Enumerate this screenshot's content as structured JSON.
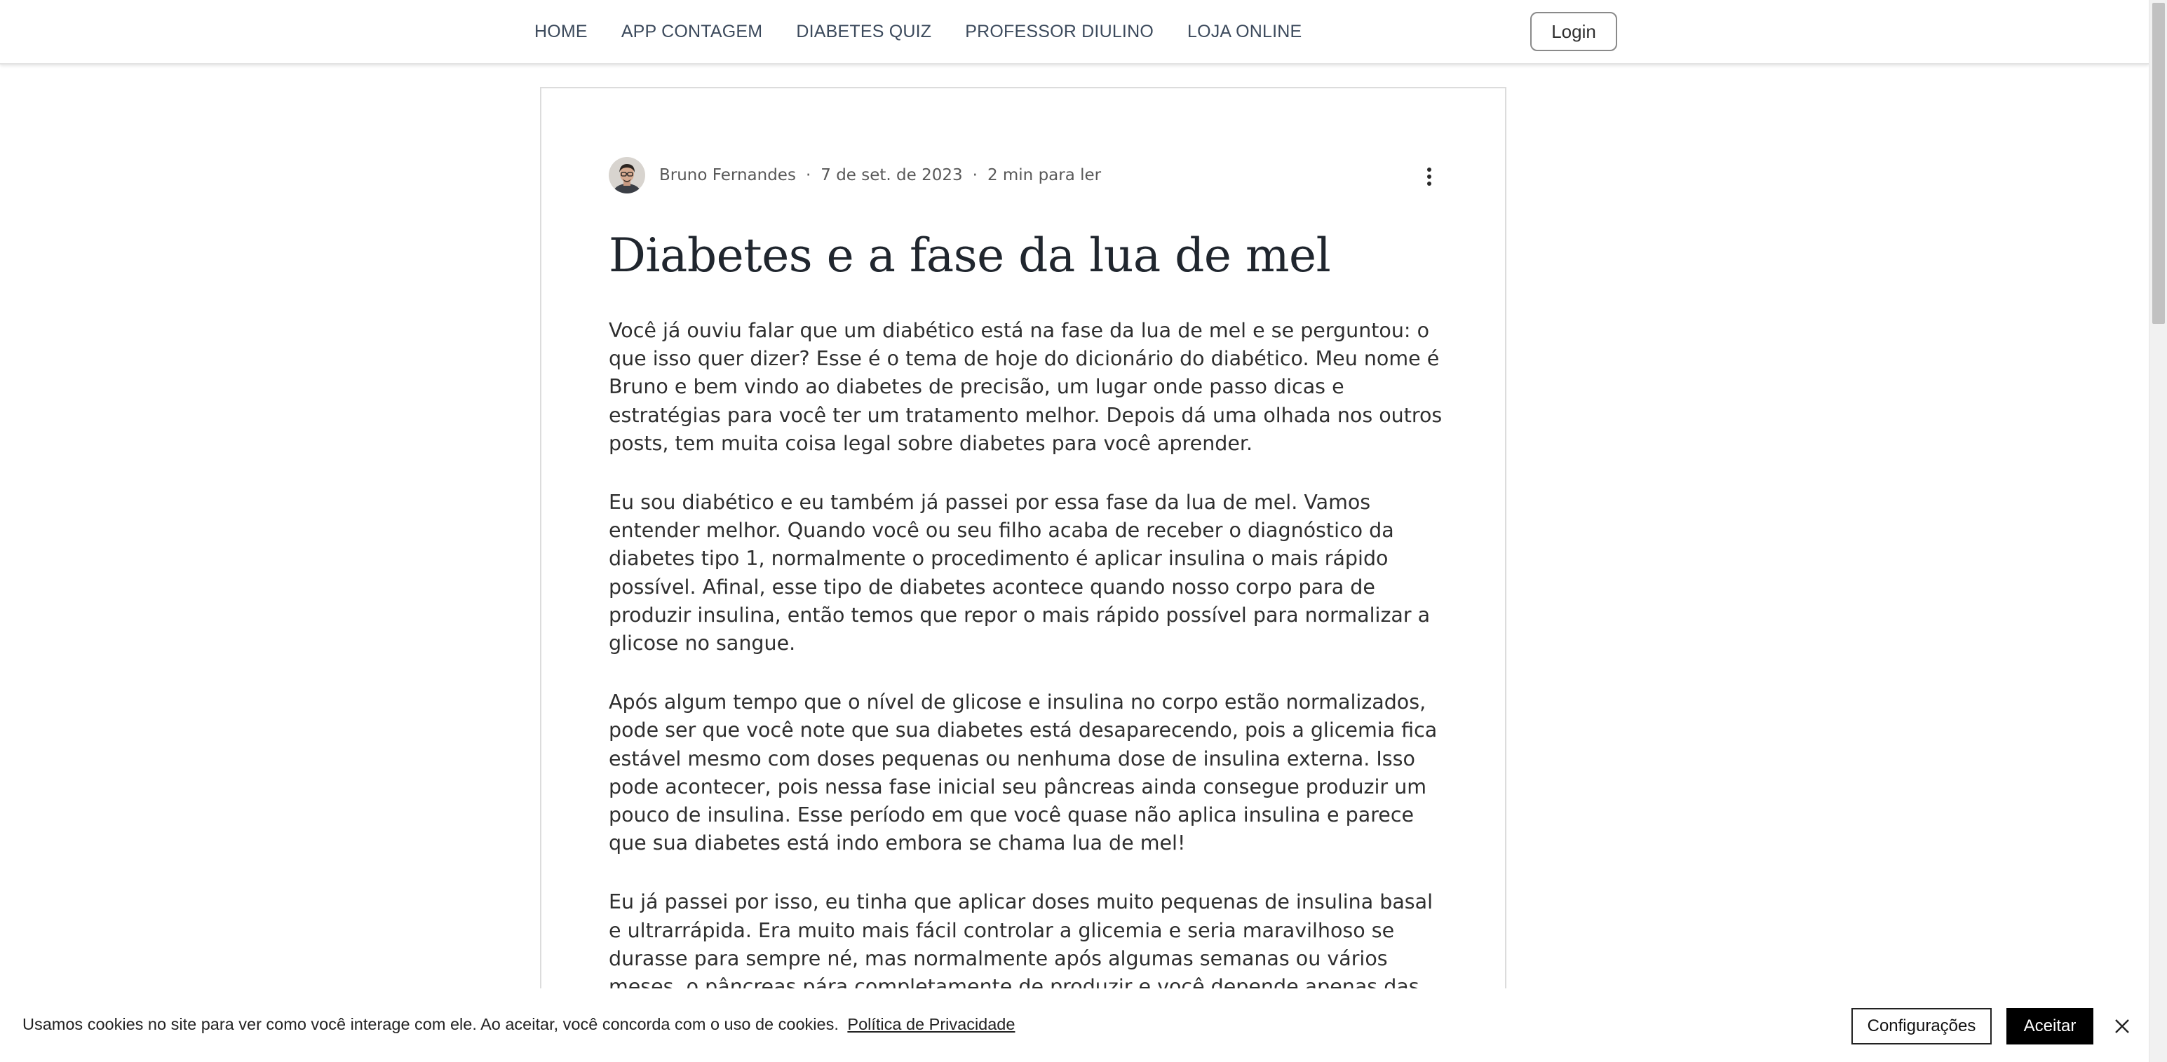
{
  "header": {
    "nav": [
      {
        "label": "HOME"
      },
      {
        "label": "APP CONTAGEM"
      },
      {
        "label": "DIABETES QUIZ"
      },
      {
        "label": "PROFESSOR DIULINO"
      },
      {
        "label": "LOJA ONLINE"
      }
    ],
    "login_label": "Login"
  },
  "post": {
    "author": "Bruno Fernandes",
    "date": "7 de set. de 2023",
    "read_time": "2 min para ler",
    "separator": "·",
    "title": "Diabetes e a fase da lua de mel",
    "paragraphs": [
      "Você já ouviu falar que um diabético está na fase da lua de mel e se perguntou: o que isso quer dizer? Esse é o tema de hoje do dicionário do diabético. Meu nome é Bruno e bem vindo ao diabetes de precisão, um lugar onde passo dicas e estratégias para você ter um tratamento melhor. Depois dá uma olhada nos outros posts, tem muita coisa legal sobre diabetes para você aprender.",
      "Eu sou diabético e eu também já passei por essa fase da lua de mel. Vamos entender melhor. Quando você ou seu filho acaba de receber o diagnóstico da diabetes tipo 1, normalmente o procedimento é aplicar insulina o mais rápido possível. Afinal, esse tipo de diabetes acontece quando nosso corpo para de produzir insulina, então temos que repor o mais rápido possível para normalizar a glicose no sangue.",
      "Após algum tempo que o nível de glicose e insulina no corpo estão normalizados, pode ser que você note que sua diabetes está desaparecendo, pois a glicemia fica estável mesmo com doses pequenas ou nenhuma dose de insulina externa. Isso pode acontecer, pois nessa fase inicial seu pâncreas ainda consegue produzir um pouco de insulina. Esse período em que você quase não aplica insulina e parece que sua diabetes está indo embora se chama lua de mel!",
      "Eu já passei por isso, eu tinha que aplicar doses muito pequenas de insulina basal e ultrarrápida. Era muito mais fácil controlar a glicemia e seria maravilhoso se durasse para sempre né, mas normalmente após algumas semanas ou vários meses, o pâncreas pára completamente de produzir e você depende apenas das aplicações de insulina para se manter saudável."
    ]
  },
  "cookie": {
    "text": "Usamos cookies no site para ver como você interage com ele. Ao aceitar, você concorda com o uso de cookies.",
    "link": "Política de Privacidade",
    "settings_label": "Configurações",
    "accept_label": "Aceitar"
  },
  "icons": {
    "more": "more-vertical-icon",
    "close": "close-icon"
  }
}
